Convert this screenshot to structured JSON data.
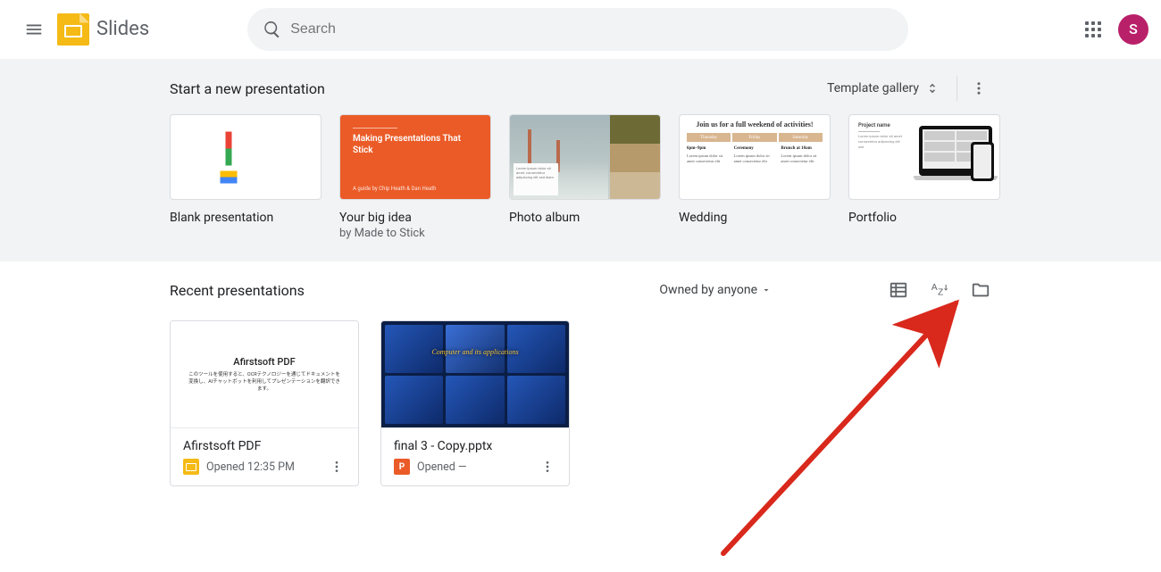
{
  "header": {
    "app_title": "Slides",
    "search_placeholder": "Search",
    "avatar_initial": "S"
  },
  "templates": {
    "section_title": "Start a new presentation",
    "gallery_label": "Template gallery",
    "items": [
      {
        "title": "Blank presentation",
        "subtitle": ""
      },
      {
        "title": "Your big idea",
        "subtitle": "by Made to Stick",
        "thumb": {
          "heading": "Making Presentations That Stick",
          "footer": "A guide by Chip Heath & Dan Heath"
        }
      },
      {
        "title": "Photo album",
        "subtitle": ""
      },
      {
        "title": "Wedding",
        "subtitle": "",
        "thumb": {
          "heading": "Join us for a full weekend of activities!",
          "tabs": [
            "Thursday",
            "Friday",
            "Saturday"
          ],
          "col_heads": [
            "6pm–9pm",
            "Ceremony",
            "Brunch at 10am"
          ]
        }
      },
      {
        "title": "Portfolio",
        "subtitle": "",
        "thumb": {
          "label": "Project name"
        }
      }
    ]
  },
  "recent": {
    "section_title": "Recent presentations",
    "owned_label": "Owned by anyone",
    "docs": [
      {
        "title": "Afirstsoft PDF",
        "type": "slides",
        "opened": "Opened 12:35 PM",
        "thumb": {
          "title": "Afirstsoft PDF",
          "subtitle": "このツールを使用すると、OCRテクノロジーを通じてドキュメントを変換し、AIチャットボットを利用してプレゼンテーションを翻訳できます。"
        }
      },
      {
        "title": "final 3 - Copy.pptx",
        "type": "pptx",
        "type_letter": "P",
        "opened": "Opened —",
        "thumb": {
          "caption": "Computer and its applications"
        }
      }
    ]
  },
  "annotation": {
    "target": "file-picker-icon"
  }
}
